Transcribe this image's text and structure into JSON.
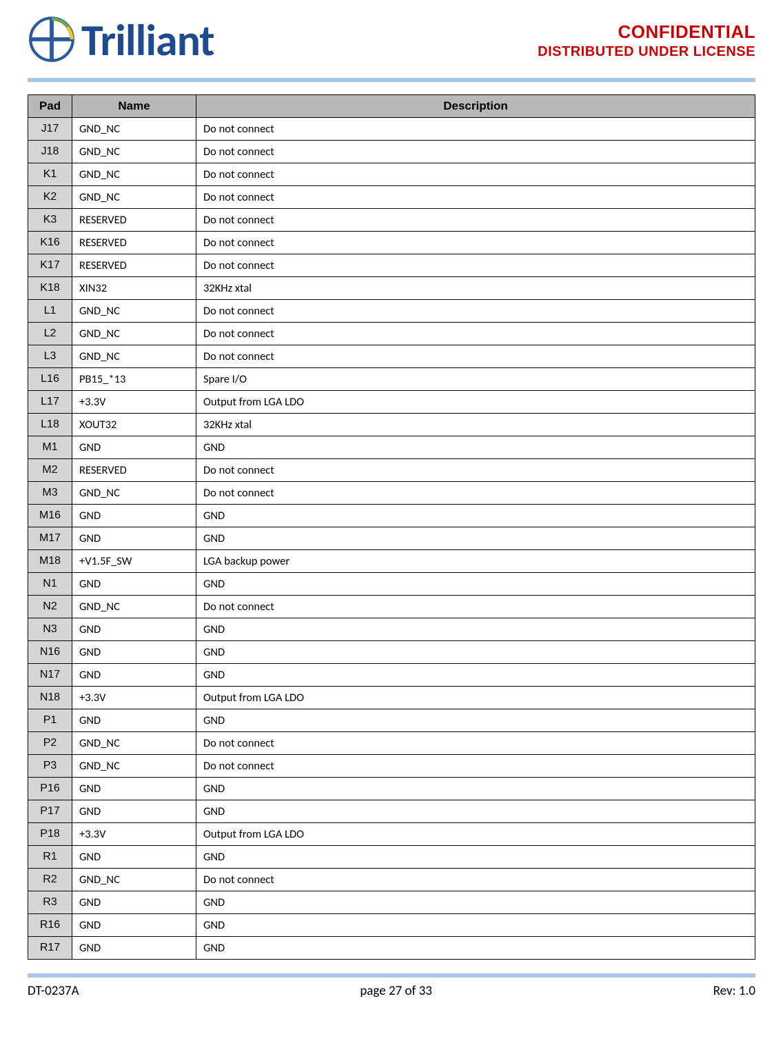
{
  "header": {
    "logo_text": "Trilliant",
    "confidential": "CONFIDENTIAL",
    "distributed": "DISTRIBUTED UNDER LICENSE"
  },
  "table": {
    "headers": {
      "pad": "Pad",
      "name": "Name",
      "description": "Description"
    },
    "rows": [
      {
        "pad": "J17",
        "name": "GND_NC",
        "desc": "Do not connect"
      },
      {
        "pad": "J18",
        "name": "GND_NC",
        "desc": "Do not connect"
      },
      {
        "pad": "K1",
        "name": "GND_NC",
        "desc": "Do not connect"
      },
      {
        "pad": "K2",
        "name": "GND_NC",
        "desc": "Do not connect"
      },
      {
        "pad": "K3",
        "name": "RESERVED",
        "desc": "Do not connect"
      },
      {
        "pad": "K16",
        "name": "RESERVED",
        "desc": "Do not connect"
      },
      {
        "pad": "K17",
        "name": "RESERVED",
        "desc": "Do not connect"
      },
      {
        "pad": "K18",
        "name": "XIN32",
        "desc": "32KHz xtal"
      },
      {
        "pad": "L1",
        "name": "GND_NC",
        "desc": "Do not connect"
      },
      {
        "pad": "L2",
        "name": "GND_NC",
        "desc": "Do not connect"
      },
      {
        "pad": "L3",
        "name": "GND_NC",
        "desc": "Do not connect"
      },
      {
        "pad": "L16",
        "name": "PB15_*13",
        "desc": "Spare I/O"
      },
      {
        "pad": "L17",
        "name": "+3.3V",
        "desc": "Output from LGA LDO"
      },
      {
        "pad": "L18",
        "name": "XOUT32",
        "desc": "32KHz xtal"
      },
      {
        "pad": "M1",
        "name": "GND",
        "desc": "GND"
      },
      {
        "pad": "M2",
        "name": "RESERVED",
        "desc": "Do not connect"
      },
      {
        "pad": "M3",
        "name": "GND_NC",
        "desc": "Do not connect"
      },
      {
        "pad": "M16",
        "name": "GND",
        "desc": "GND"
      },
      {
        "pad": "M17",
        "name": "GND",
        "desc": "GND"
      },
      {
        "pad": "M18",
        "name": " +V1.5F_SW",
        "desc": "LGA backup power"
      },
      {
        "pad": "N1",
        "name": "GND",
        "desc": "GND"
      },
      {
        "pad": "N2",
        "name": "GND_NC",
        "desc": "Do not connect"
      },
      {
        "pad": "N3",
        "name": "GND",
        "desc": "GND"
      },
      {
        "pad": "N16",
        "name": "GND",
        "desc": "GND"
      },
      {
        "pad": "N17",
        "name": "GND",
        "desc": "GND"
      },
      {
        "pad": "N18",
        "name": " +3.3V",
        "desc": "Output from LGA LDO"
      },
      {
        "pad": "P1",
        "name": "GND",
        "desc": "GND"
      },
      {
        "pad": "P2",
        "name": "GND_NC",
        "desc": "Do not connect"
      },
      {
        "pad": "P3",
        "name": "GND_NC",
        "desc": "Do not connect"
      },
      {
        "pad": "P16",
        "name": "GND",
        "desc": "GND"
      },
      {
        "pad": "P17",
        "name": "GND",
        "desc": "GND"
      },
      {
        "pad": "P18",
        "name": " +3.3V",
        "desc": "Output from LGA LDO"
      },
      {
        "pad": "R1",
        "name": "GND",
        "desc": "GND"
      },
      {
        "pad": "R2",
        "name": "GND_NC",
        "desc": "Do not connect"
      },
      {
        "pad": "R3",
        "name": "GND",
        "desc": "GND"
      },
      {
        "pad": "R16",
        "name": "GND",
        "desc": "GND"
      },
      {
        "pad": "R17",
        "name": "GND",
        "desc": "GND"
      }
    ]
  },
  "footer": {
    "doc_id": "DT-0237A",
    "page": "page 27 of 33",
    "rev": "Rev: 1.0"
  }
}
